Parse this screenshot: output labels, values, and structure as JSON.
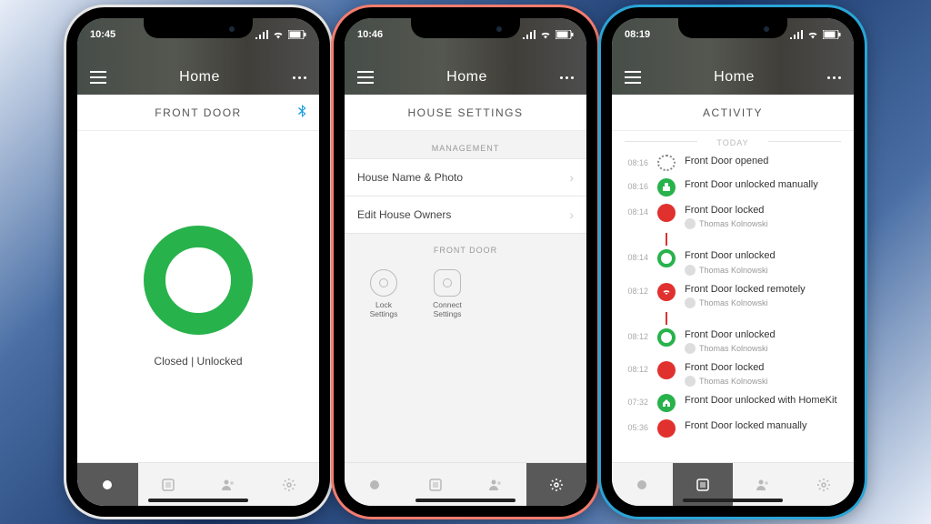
{
  "phones": [
    {
      "frame_color": "white",
      "status_time": "10:45",
      "header_title": "Home",
      "page_title": "FRONT DOOR",
      "bluetooth": true,
      "lock_status": "Closed | Unlocked",
      "active_tab": 0
    },
    {
      "frame_color": "coral",
      "status_time": "10:46",
      "header_title": "Home",
      "page_title": "HOUSE SETTINGS",
      "sections": {
        "management_label": "MANAGEMENT",
        "management_rows": [
          "House Name & Photo",
          "Edit House Owners"
        ],
        "frontdoor_label": "FRONT DOOR",
        "tiles": [
          {
            "label": "Lock\nSettings",
            "shape": "round"
          },
          {
            "label": "Connect\nSettings",
            "shape": "square"
          }
        ]
      },
      "active_tab": 3
    },
    {
      "frame_color": "blue",
      "status_time": "08:19",
      "header_title": "Home",
      "page_title": "ACTIVITY",
      "day_label": "TODAY",
      "activity": [
        {
          "time": "08:16",
          "icon": "dashed",
          "title": "Front Door opened"
        },
        {
          "time": "08:16",
          "icon": "green-solid",
          "title": "Front Door unlocked manually"
        },
        {
          "time": "08:14",
          "icon": "red-solid",
          "title": "Front Door locked",
          "user": "Thomas Kolnowski",
          "timeline_after": true
        },
        {
          "time": "08:14",
          "icon": "green-ring",
          "title": "Front Door unlocked",
          "user": "Thomas Kolnowski"
        },
        {
          "time": "08:12",
          "icon": "red-wifi",
          "title": "Front Door locked remotely",
          "user": "Thomas Kolnowski",
          "timeline_after": true
        },
        {
          "time": "08:12",
          "icon": "green-ring",
          "title": "Front Door unlocked",
          "user": "Thomas Kolnowski"
        },
        {
          "time": "08:12",
          "icon": "red-solid",
          "title": "Front Door locked",
          "user": "Thomas Kolnowski"
        },
        {
          "time": "07:32",
          "icon": "green-home",
          "title": "Front Door unlocked with HomeKit"
        },
        {
          "time": "05:36",
          "icon": "red-solid",
          "title": "Front Door locked manually"
        }
      ],
      "active_tab": 1
    }
  ],
  "tab_icons": [
    "circle",
    "list",
    "people",
    "gear"
  ]
}
